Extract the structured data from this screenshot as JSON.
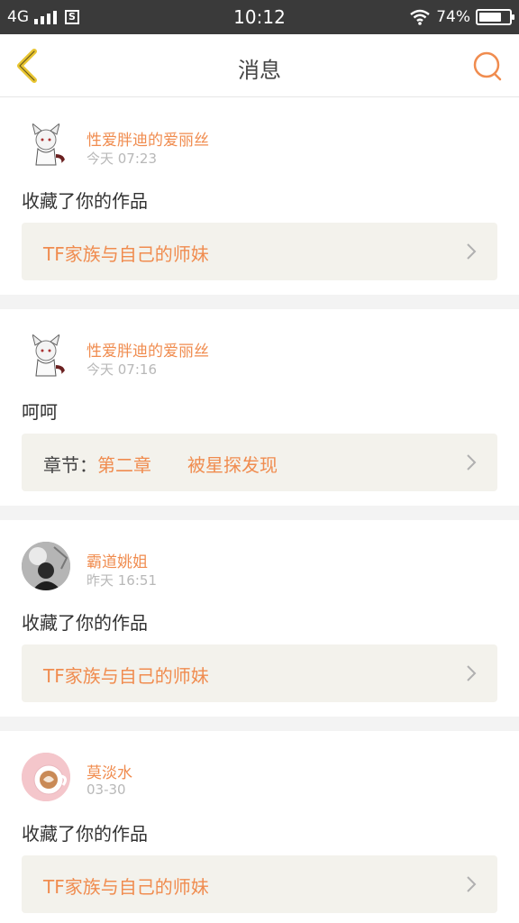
{
  "status_bar": {
    "network": "4G",
    "time": "10:12",
    "battery": "74%",
    "battery_level": 0.74
  },
  "header": {
    "title": "消息",
    "accent_color": "#f08c4f",
    "back_color": "#e8c531"
  },
  "messages": [
    {
      "user": "性爱胖迪的爱丽丝",
      "time": "今天 07:23",
      "text": "收藏了你的作品",
      "ref": {
        "text": "TF家族与自己的师妹"
      }
    },
    {
      "user": "性爱胖迪的爱丽丝",
      "time": "今天 07:16",
      "text": "呵呵",
      "ref": {
        "label": "章节：",
        "chapter": "第二章",
        "title": "被星探发现"
      }
    },
    {
      "user": "霸道姚姐",
      "time": "昨天 16:51",
      "text": "收藏了你的作品",
      "ref": {
        "text": "TF家族与自己的师妹"
      }
    },
    {
      "user": "莫淡水",
      "time": "03-30",
      "text": "收藏了你的作品",
      "ref": {
        "text": "TF家族与自己的师妹"
      }
    }
  ]
}
